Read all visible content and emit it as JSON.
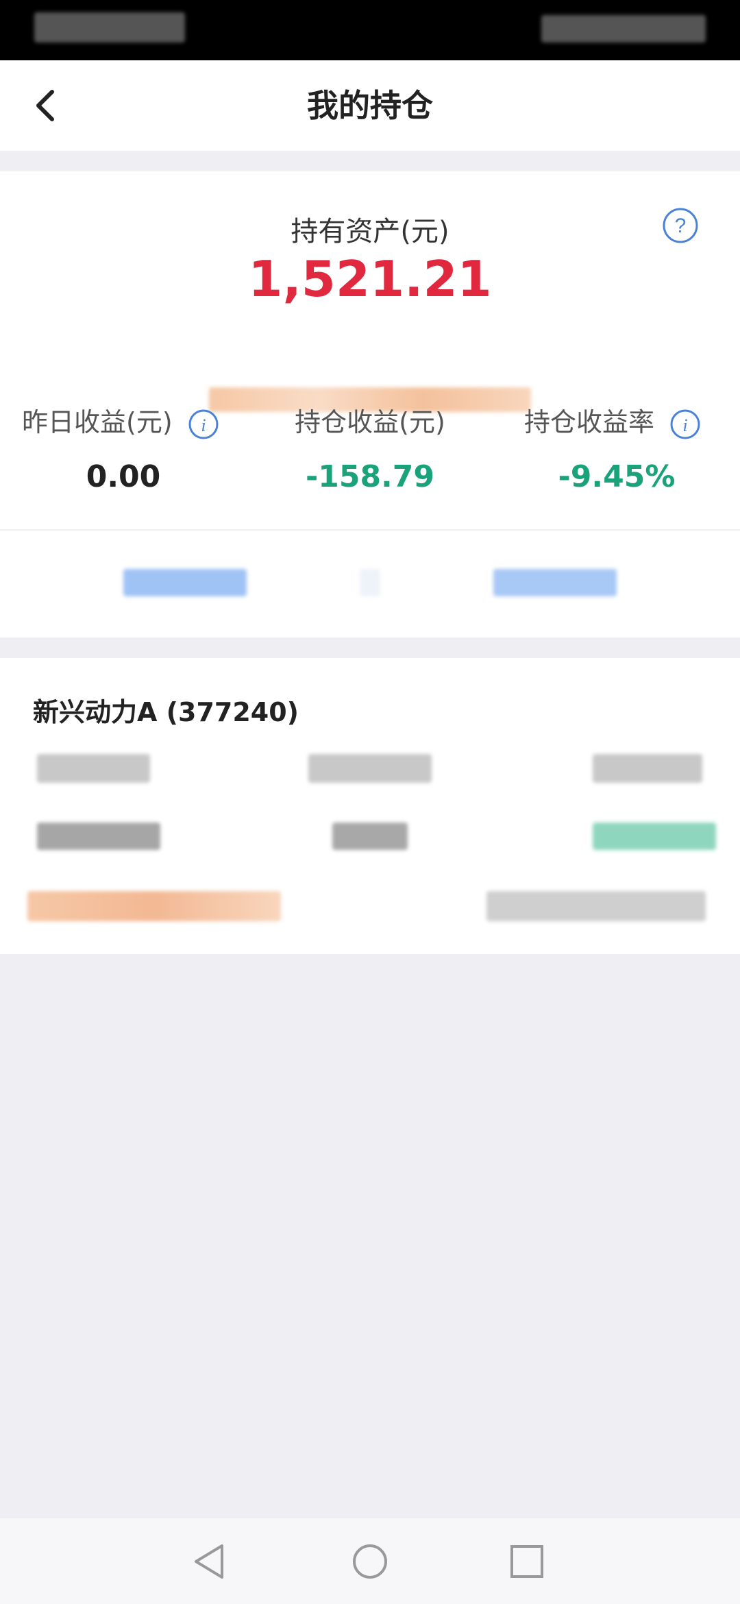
{
  "header": {
    "title": "我的持仓"
  },
  "summary": {
    "asset_label": "持有资产(元)",
    "asset_value": "1,521.21",
    "metrics": [
      {
        "label": "昨日收益(元)",
        "value": "0.00",
        "color": "#222222"
      },
      {
        "label": "持仓收益(元)",
        "value": "-158.79",
        "color": "#1aa37a"
      },
      {
        "label": "持仓收益率",
        "value": "-9.45%",
        "color": "#1aa37a"
      }
    ]
  },
  "holding": {
    "fund_name": "新兴动力A (377240)"
  },
  "colors": {
    "asset_red": "#e0283e",
    "loss_green": "#1aa37a",
    "icon_blue": "#4a82d8",
    "page_bg": "#eeeef3"
  }
}
